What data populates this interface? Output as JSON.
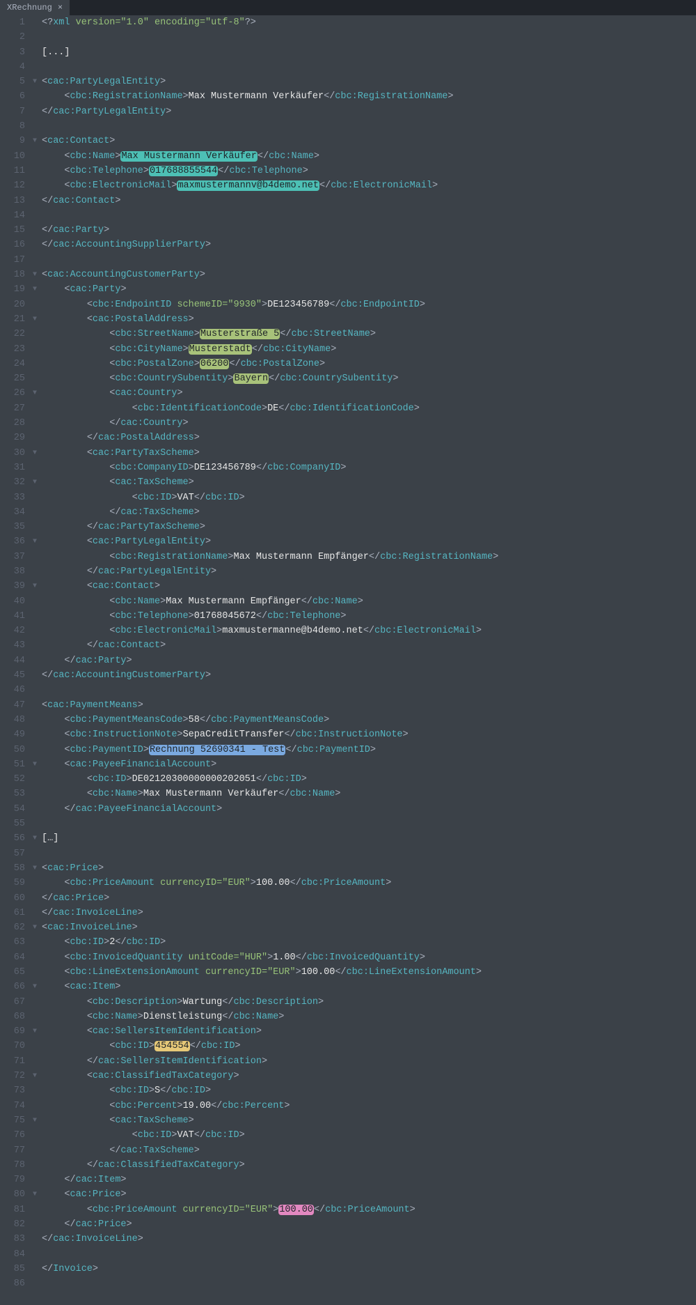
{
  "tab": {
    "name": "XRechnung"
  },
  "lines": {
    "start": 1,
    "end": 86,
    "fold_markers": [
      5,
      9,
      18,
      19,
      21,
      26,
      30,
      32,
      36,
      39,
      51,
      56,
      58,
      62,
      66,
      69,
      72,
      75,
      80
    ]
  },
  "hl": {
    "contact_name": "Max Mustermann Verkäufer",
    "contact_phone": "017688855544",
    "contact_mail": "maxmustermannv@b4demo.net",
    "street": "Musterstraße 5",
    "city": "Musterstadt",
    "postal": "06200",
    "subentity": "Bayern",
    "payment_id": "Rechnung 52690341 - Test",
    "item_id": "454554",
    "price2": "100.00"
  },
  "vals": {
    "xml_decl_version": "\"1.0\"",
    "xml_decl_enc": "\"utf-8\"",
    "ellipsis1": "[...]",
    "ellipsis2": "[…]",
    "seller_reg_name": "Max Mustermann Verkäufer",
    "schemeID": "\"9930\"",
    "endpoint": "DE123456789",
    "country_code": "DE",
    "company_id": "DE123456789",
    "vat": "VAT",
    "recipient_reg_name": "Max Mustermann Empfänger",
    "recipient_contact_name": "Max Mustermann Empfänger",
    "recipient_phone": "01768045672",
    "recipient_mail": "maxmustermanne@b4demo.net",
    "pm_code": "58",
    "instr_note": "SepaCreditTransfer",
    "iban": "DE02120300000000202051",
    "payee_name": "Max Mustermann Verkäufer",
    "currencyID": "\"EUR\"",
    "price1": "100.00",
    "inv_id": "2",
    "unitCode": "\"HUR\"",
    "qty": "1.00",
    "line_ext": "100.00",
    "desc": "Wartung",
    "item_name": "Dienstleistung",
    "tax_id": "S",
    "percent": "19.00"
  }
}
